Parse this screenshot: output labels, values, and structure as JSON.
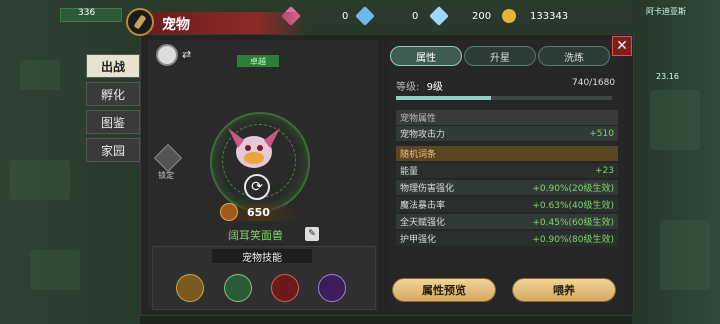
{
  "hud": {
    "left_value": "336",
    "res1_value": "0",
    "res2_value": "0",
    "res3_value": "200",
    "gold_value": "133343",
    "location": "阿卡迪亚斯",
    "map_level": "23.16"
  },
  "title": "宠物",
  "tabs": [
    "出战",
    "孵化",
    "图鉴",
    "家园"
  ],
  "pet": {
    "status_badge": "卓越",
    "lock_label": "锁定",
    "power": "650",
    "name": "阔耳笑面兽"
  },
  "skills": {
    "header": "宠物技能"
  },
  "right_tabs": [
    "属性",
    "升星",
    "洗炼"
  ],
  "level": {
    "label": "等级:",
    "value": "9级",
    "exp": "740/1680",
    "progress": 0.44
  },
  "attributes": {
    "section_title": "宠物属性",
    "rows": [
      {
        "name": "宠物攻击力",
        "value": "+510"
      }
    ]
  },
  "random_affix": {
    "section_title": "随机词条",
    "rows": [
      {
        "name": "能量",
        "value": "+23"
      },
      {
        "name": "物理伤害强化",
        "value": "+0.90%(20级生效)"
      },
      {
        "name": "魔法暴击率",
        "value": "+0.63%(40级生效)"
      },
      {
        "name": "全天赋强化",
        "value": "+0.45%(60级生效)"
      },
      {
        "name": "护甲强化",
        "value": "+0.90%(80级生效)"
      }
    ]
  },
  "buttons": {
    "preview": "属性预览",
    "feed": "喂养"
  },
  "colors": {
    "accent_green": "#7fd66a",
    "title_red": "#8c2a2a",
    "gold": "#d5a85f"
  }
}
